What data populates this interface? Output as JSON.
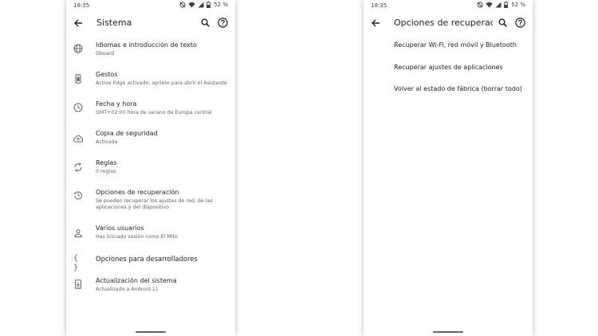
{
  "status_bar": {
    "time": "18:35",
    "battery": "52 %"
  },
  "left_screen": {
    "title": "Sistema",
    "items": [
      {
        "title": "Idiomas e introducción de texto",
        "subtitle": "Gboard",
        "icon": "globe-icon"
      },
      {
        "title": "Gestos",
        "subtitle": "Active Edge activado, apriete para abrir el Asistente",
        "icon": "phone-gesture-icon"
      },
      {
        "title": "Fecha y hora",
        "subtitle": "GMT+02:00 hora de verano de Europa central",
        "icon": "clock-icon"
      },
      {
        "title": "Copia de seguridad",
        "subtitle": "Activada",
        "icon": "cloud-upload-icon"
      },
      {
        "title": "Reglas",
        "subtitle": "0 reglas",
        "icon": "rules-icon"
      },
      {
        "title": "Opciones de recuperación",
        "subtitle": "Se pueden recuperar los ajustes de red, de las aplicaciones y del dispositivo",
        "icon": "history-icon"
      },
      {
        "title": "Varios usuarios",
        "subtitle": "Has iniciado sesión como El Mito",
        "icon": "person-icon"
      },
      {
        "title": "Opciones para desarrolladores",
        "subtitle": "",
        "icon": "code-braces-icon"
      },
      {
        "title": "Actualización del sistema",
        "subtitle": "Actualizado a Android 11",
        "icon": "system-update-icon"
      }
    ]
  },
  "right_screen": {
    "title": "Opciones de recuperac...",
    "items": [
      {
        "title": "Recuperar Wi-Fi, red móvil y Bluetooth"
      },
      {
        "title": "Recuperar ajustes de aplicaciones"
      },
      {
        "title": "Volver al estado de fábrica (borrar todo)"
      }
    ]
  }
}
